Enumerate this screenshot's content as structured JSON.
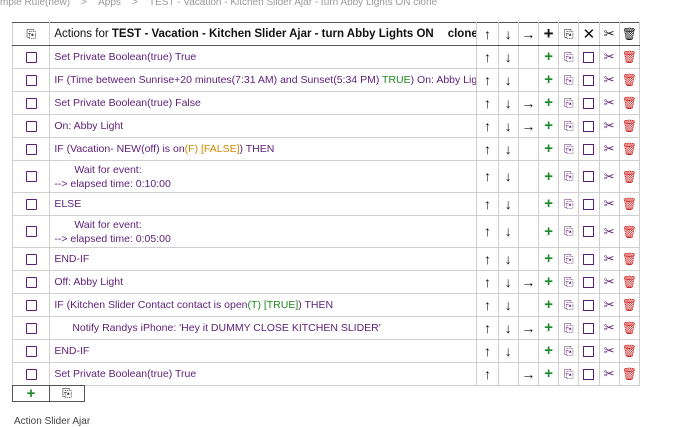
{
  "breadcrumb": {
    "parts": [
      "mple Rule(new)",
      ">",
      "Apps",
      ">",
      "TEST - Vacation - Kitchen Slider Ajar - turn Abby Lights ON clone"
    ]
  },
  "header": {
    "prefix": "Actions for ",
    "rule_name": "TEST - Vacation - Kitchen Slider Ajar  - turn Abby Lights ON",
    "suffix": "clone",
    "icons": {
      "up": "↑",
      "down": "↓",
      "right": "→",
      "add": "+",
      "copy": "⎘",
      "cancel": "✕",
      "cut": "✂",
      "delete": "🗑"
    }
  },
  "rows": [
    {
      "type": "simple",
      "segments": [
        [
          "",
          "Set Private Boolean(true) "
        ],
        [
          "",
          "True"
        ]
      ],
      "up": true,
      "down": true,
      "right": false
    },
    {
      "type": "simple",
      "segments": [
        [
          "",
          "IF (Time between Sunrise+20 minutes(7:31 AM) and Sunset(5:34 PM) "
        ],
        [
          "green",
          "TRUE"
        ],
        [
          "",
          ") On: Abby Light"
        ]
      ],
      "up": true,
      "down": true,
      "right": false
    },
    {
      "type": "simple",
      "segments": [
        [
          "",
          "Set Private Boolean(true) False"
        ]
      ],
      "up": true,
      "down": true,
      "right": true
    },
    {
      "type": "simple",
      "segments": [
        [
          "",
          "On: Abby Light"
        ]
      ],
      "up": true,
      "down": true,
      "right": true
    },
    {
      "type": "simple",
      "segments": [
        [
          "",
          "IF (Vacation- NEW(off) is on"
        ],
        [
          "orange",
          "(F) [FALSE]"
        ],
        [
          "",
          ") THEN"
        ]
      ],
      "up": true,
      "down": true,
      "right": false
    },
    {
      "type": "tall",
      "line1": "Wait for event:",
      "line2": "--> elapsed time: 0:10:00",
      "up": true,
      "down": true,
      "right": false
    },
    {
      "type": "simple",
      "segments": [
        [
          "",
          "ELSE"
        ]
      ],
      "up": true,
      "down": true,
      "right": false
    },
    {
      "type": "tall",
      "line1": "Wait for event:",
      "line2": "--> elapsed time: 0:05:00",
      "up": true,
      "down": true,
      "right": false
    },
    {
      "type": "simple",
      "segments": [
        [
          "",
          "END-IF"
        ]
      ],
      "up": true,
      "down": true,
      "right": false
    },
    {
      "type": "simple",
      "segments": [
        [
          "",
          "Off: Abby Light"
        ]
      ],
      "up": true,
      "down": true,
      "right": true
    },
    {
      "type": "simple",
      "segments": [
        [
          "",
          "IF (Kitchen Slider Contact contact is open"
        ],
        [
          "green",
          "(T) [TRUE]"
        ],
        [
          "",
          ") THEN"
        ]
      ],
      "up": true,
      "down": true,
      "right": false
    },
    {
      "type": "simple",
      "indent": true,
      "segments": [
        [
          "",
          "Notify Randys iPhone: 'Hey it DUMMY CLOSE KITCHEN SLIDER'"
        ]
      ],
      "up": true,
      "down": true,
      "right": true
    },
    {
      "type": "simple",
      "segments": [
        [
          "",
          "END-IF"
        ]
      ],
      "up": true,
      "down": true,
      "right": false
    },
    {
      "type": "simple",
      "segments": [
        [
          "",
          "Set Private Boolean(true) "
        ],
        [
          "",
          "True"
        ]
      ],
      "up": true,
      "down": false,
      "right": true
    }
  ],
  "row_icons": {
    "up": "↑",
    "down": "↓",
    "right": "→",
    "add": "+",
    "copy": "⎘",
    "cut": "✂",
    "delete": "🗑"
  },
  "footer": {
    "add": "+",
    "copy": "⎘"
  },
  "bottom_text": "Action Slider Ajar",
  "colors": {
    "action_text": "#5c1e78",
    "true_green": "#1f8a1f",
    "false_orange": "#d08a00",
    "delete_red": "#cc1f1f"
  }
}
